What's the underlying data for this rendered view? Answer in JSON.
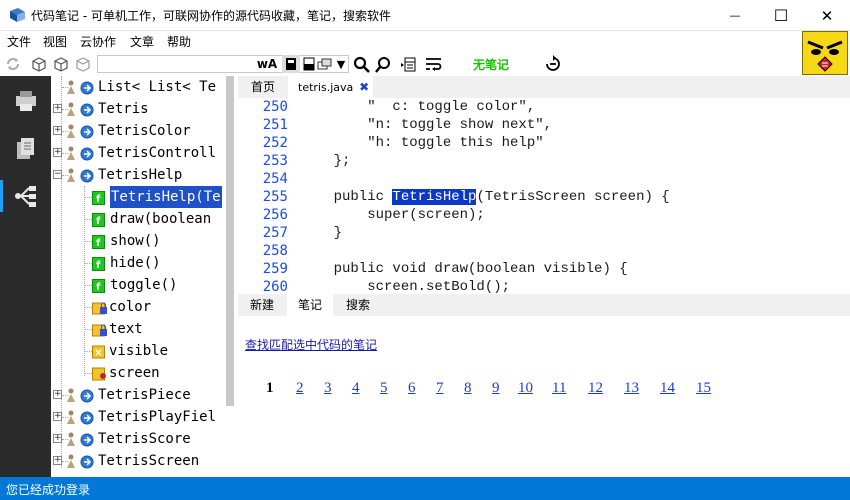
{
  "window": {
    "title": "代码笔记 - 可单机工作，可联网协作的源代码收藏，笔记，搜索软件",
    "minimize_glyph": "—",
    "maximize_glyph": "☐",
    "close_glyph": "✕"
  },
  "menu": [
    "文件",
    "视图",
    "云协作",
    "文章",
    "帮助"
  ],
  "toolbar": {
    "notes_status": "无笔记",
    "font_label": "wA"
  },
  "tree": {
    "rows": [
      {
        "label": "List< List< Te",
        "expander": "",
        "icon": "class"
      },
      {
        "label": "Tetris",
        "expander": "+",
        "icon": "class"
      },
      {
        "label": "TetrisColor",
        "expander": "+",
        "icon": "class"
      },
      {
        "label": "TetrisControll",
        "expander": "+",
        "icon": "class"
      },
      {
        "label": "TetrisHelp",
        "expander": "−",
        "icon": "class"
      },
      {
        "label": "TetrisHelp(Te",
        "expander": "",
        "icon": "method"
      },
      {
        "label": "draw(boolean",
        "expander": "",
        "icon": "method"
      },
      {
        "label": "show()",
        "expander": "",
        "icon": "method"
      },
      {
        "label": "hide()",
        "expander": "",
        "icon": "method"
      },
      {
        "label": "toggle()",
        "expander": "",
        "icon": "method"
      },
      {
        "label": "color",
        "expander": "",
        "icon": "field-locked"
      },
      {
        "label": "text",
        "expander": "",
        "icon": "field-locked"
      },
      {
        "label": "visible",
        "expander": "",
        "icon": "field"
      },
      {
        "label": "screen",
        "expander": "",
        "icon": "field-key"
      },
      {
        "label": "TetrisPiece",
        "expander": "+",
        "icon": "class"
      },
      {
        "label": "TetrisPlayFiel",
        "expander": "+",
        "icon": "class"
      },
      {
        "label": "TetrisScore",
        "expander": "+",
        "icon": "class"
      },
      {
        "label": "TetrisScreen",
        "expander": "+",
        "icon": "class"
      }
    ]
  },
  "tabs": [
    {
      "label": "首页"
    },
    {
      "label": "tetris.java"
    }
  ],
  "tab_close_glyph": "✖",
  "code": {
    "lines": [
      {
        "num": "250",
        "text": "        \"  c: toggle color\","
      },
      {
        "num": "251",
        "text": "        \"n: toggle show next\","
      },
      {
        "num": "252",
        "text": "        \"h: toggle this help\""
      },
      {
        "num": "253",
        "text": "    };"
      },
      {
        "num": "254",
        "text": ""
      },
      {
        "num": "255",
        "pre": "    public ",
        "hl": "TetrisHelp",
        "post": "(TetrisScreen screen) {"
      },
      {
        "num": "256",
        "text": "        super(screen);"
      },
      {
        "num": "257",
        "text": "    }"
      },
      {
        "num": "258",
        "text": ""
      },
      {
        "num": "259",
        "text": "    public void draw(boolean visible) {"
      },
      {
        "num": "260",
        "text": "        screen.setBold();"
      }
    ]
  },
  "bottom_tabs": [
    "新建",
    "笔记",
    "搜索"
  ],
  "find_link": "查找匹配选中代码的笔记",
  "pager": {
    "current": "1",
    "pages": [
      "2",
      "3",
      "4",
      "5",
      "6",
      "7",
      "8",
      "9",
      "10",
      "11",
      "12",
      "13",
      "14",
      "15"
    ]
  },
  "status": "您已经成功登录",
  "colors": {
    "accent": "#0078d7",
    "selection": "#1e50c8",
    "line_numbers": "#1a4de0",
    "notes_status": "#13c400"
  }
}
